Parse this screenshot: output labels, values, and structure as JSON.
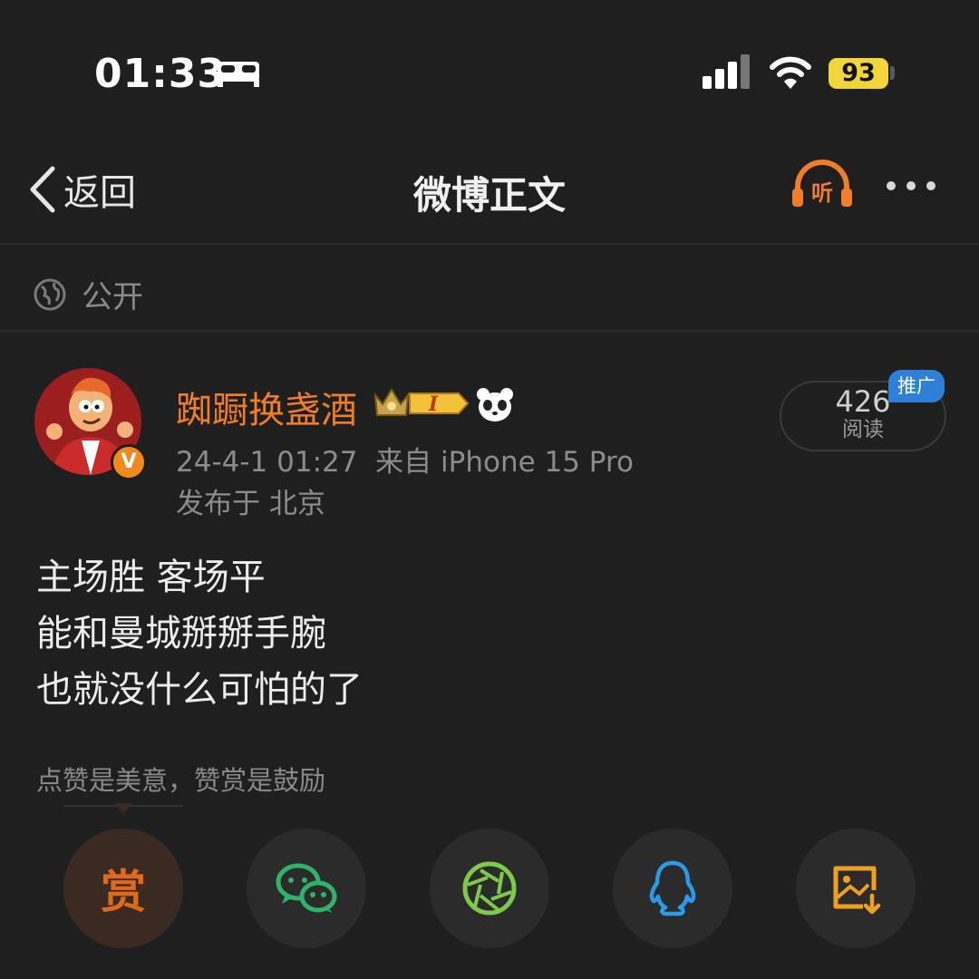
{
  "status_bar": {
    "time": "01:33",
    "battery": "93"
  },
  "nav": {
    "back_label": "返回",
    "title": "微博正文",
    "listen_label": "听"
  },
  "visibility": {
    "label": "公开"
  },
  "author": {
    "name": "踟蹰换盏酒",
    "verified_mark": "V",
    "member_badge": "I",
    "meta": "24-4-1 01:27  来自 iPhone 15 Pro",
    "location": "发布于 北京"
  },
  "read": {
    "count": "426",
    "label": "阅读",
    "promo": "推广"
  },
  "post": {
    "lines": [
      "主场胜 客场平",
      "能和曼城掰掰手腕",
      "也就没什么可怕的了"
    ]
  },
  "reward_tip": "点赞是美意，赞赏是鼓励",
  "share": {
    "reward_label": "赏"
  },
  "colors": {
    "accent": "#f07d28",
    "background": "#1f1f1f",
    "wechat": "#2fb36b",
    "moments": "#7ecb4a",
    "qq": "#2a9be8",
    "save": "#f0a020"
  }
}
